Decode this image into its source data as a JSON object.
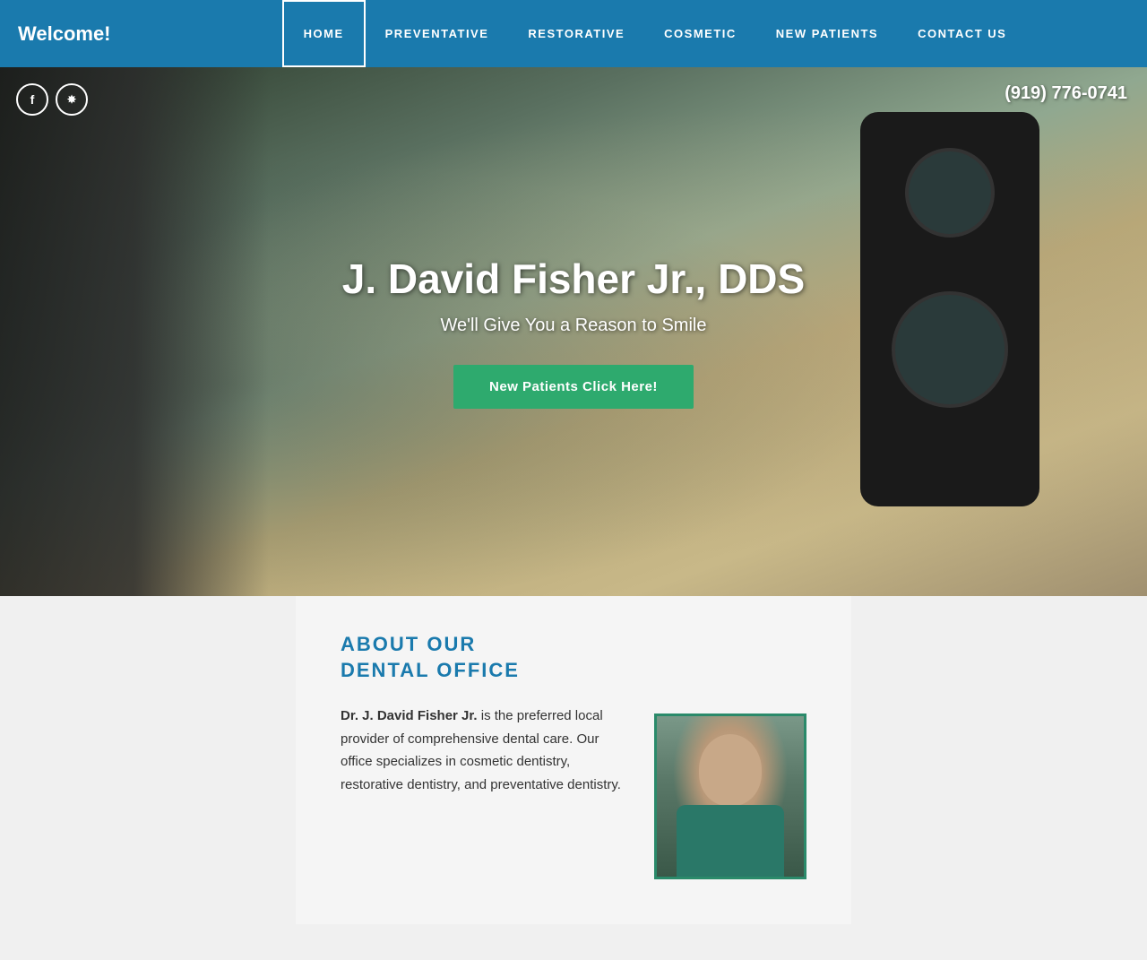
{
  "header": {
    "welcome": "Welcome!",
    "nav": [
      {
        "label": "HOME",
        "id": "home",
        "active": true
      },
      {
        "label": "PREVENTATIVE",
        "id": "preventative",
        "active": false
      },
      {
        "label": "RESTORATIVE",
        "id": "restorative",
        "active": false
      },
      {
        "label": "COSMETIC",
        "id": "cosmetic",
        "active": false
      },
      {
        "label": "NEW PATIENTS",
        "id": "new-patients",
        "active": false
      },
      {
        "label": "CONTACT US",
        "id": "contact-us",
        "active": false
      }
    ]
  },
  "hero": {
    "title": "J. David Fisher Jr., DDS",
    "subtitle": "We'll Give You a Reason to Smile",
    "cta_button": "New Patients Click Here!",
    "phone": "(919) 776-0741",
    "social": [
      {
        "label": "f",
        "name": "facebook"
      },
      {
        "label": "ʯ",
        "name": "yelp"
      }
    ]
  },
  "about": {
    "heading_line1": "ABOUT OUR",
    "heading_line2": "DENTAL OFFICE",
    "body_bold": "Dr. J. David Fisher Jr.",
    "body_text": " is the preferred local provider of comprehensive dental care. Our office specializes in cosmetic dentistry, restorative dentistry, and preventative dentistry."
  },
  "colors": {
    "header_bg": "#1a7aad",
    "nav_active_border": "#ffffff",
    "hero_btn_bg": "#2eaa6e",
    "about_heading": "#1a7aad"
  }
}
